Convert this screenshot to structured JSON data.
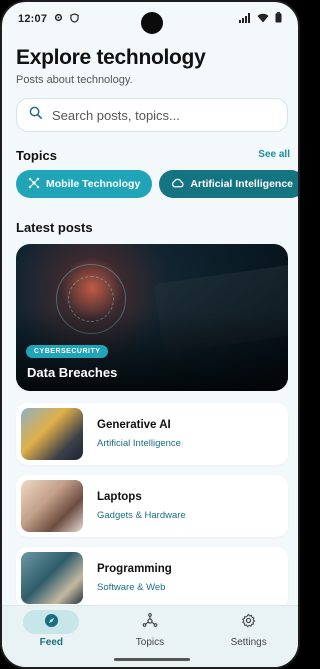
{
  "status_bar": {
    "time": "12:07"
  },
  "header": {
    "title": "Explore technology",
    "subtitle": "Posts about technology."
  },
  "search": {
    "placeholder": "Search posts, topics..."
  },
  "topics": {
    "heading": "Topics",
    "see_all": "See all",
    "chips": [
      {
        "label": "Mobile Technology",
        "icon": "nodes-icon"
      },
      {
        "label": "Artificial Intelligence",
        "icon": "cloud-icon"
      },
      {
        "label": "",
        "icon": "phone-icon"
      }
    ]
  },
  "latest": {
    "heading": "Latest posts",
    "featured": {
      "badge": "CYBERSECURITY",
      "title": "Data Breaches"
    },
    "posts": [
      {
        "title": "Generative AI",
        "category": "Artificial Intelligence"
      },
      {
        "title": "Laptops",
        "category": "Gadgets & Hardware"
      },
      {
        "title": "Programming",
        "category": "Software & Web"
      }
    ]
  },
  "nav": {
    "items": [
      {
        "label": "Feed",
        "icon": "compass-icon",
        "active": true
      },
      {
        "label": "Topics",
        "icon": "hub-icon",
        "active": false
      },
      {
        "label": "Settings",
        "icon": "gear-icon",
        "active": false
      }
    ]
  },
  "colors": {
    "accent": "#20a5b8",
    "accent_dark": "#157482",
    "background": "#f3f9fa"
  }
}
